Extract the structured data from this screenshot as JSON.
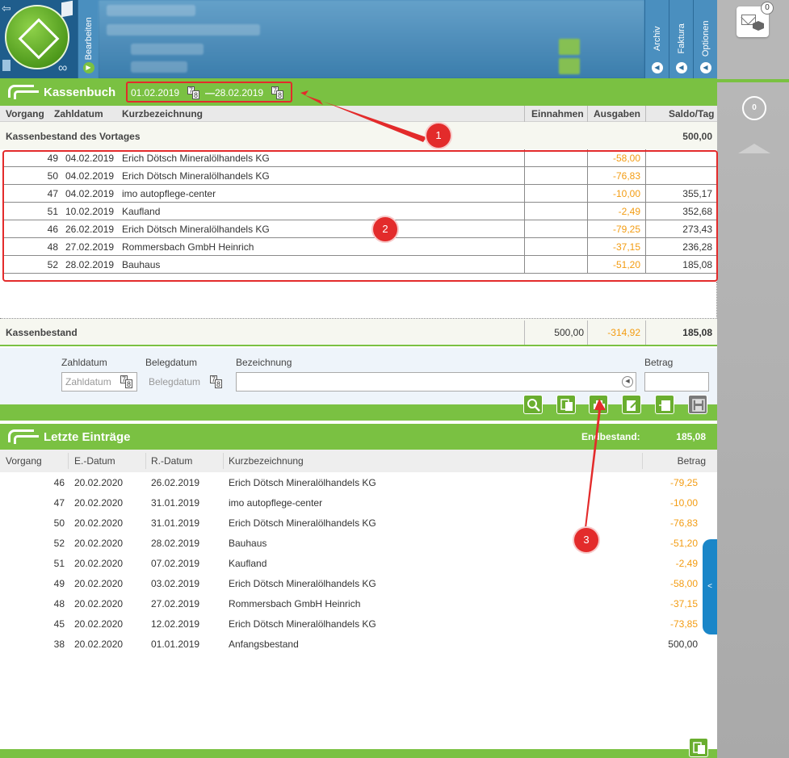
{
  "topbar": {
    "tabs": [
      {
        "label": "Bearbeiten"
      },
      {
        "label": "Archiv"
      },
      {
        "label": "Faktura"
      },
      {
        "label": "Optionen"
      }
    ]
  },
  "rightpanel": {
    "mail_badge": "0",
    "count": "0"
  },
  "kassenbuch": {
    "title": "Kassenbuch",
    "date_from": "01.02.2019",
    "date_sep": "—",
    "date_to": "28.02.2019",
    "cal_top": "7",
    "cal_bottom": "8",
    "columns": {
      "vorgang": "Vorgang",
      "zahldatum": "Zahldatum",
      "kurzbezeichnung": "Kurzbezeichnung",
      "einnahmen": "Einnahmen",
      "ausgaben": "Ausgaben",
      "saldo": "Saldo/Tag"
    },
    "prev_label": "Kassenbestand des Vortages",
    "prev_value": "500,00",
    "rows": [
      {
        "vorgang": "49",
        "datum": "04.02.2019",
        "bez": "Erich Dötsch Mineralölhandels KG",
        "einnahmen": "",
        "ausgaben": "-58,00",
        "saldo": ""
      },
      {
        "vorgang": "50",
        "datum": "04.02.2019",
        "bez": "Erich Dötsch Mineralölhandels KG",
        "einnahmen": "",
        "ausgaben": "-76,83",
        "saldo": ""
      },
      {
        "vorgang": "47",
        "datum": "04.02.2019",
        "bez": "imo autopflege-center",
        "einnahmen": "",
        "ausgaben": "-10,00",
        "saldo": "355,17"
      },
      {
        "vorgang": "51",
        "datum": "10.02.2019",
        "bez": "Kaufland",
        "einnahmen": "",
        "ausgaben": "-2,49",
        "saldo": "352,68"
      },
      {
        "vorgang": "46",
        "datum": "26.02.2019",
        "bez": "Erich Dötsch Mineralölhandels KG",
        "einnahmen": "",
        "ausgaben": "-79,25",
        "saldo": "273,43"
      },
      {
        "vorgang": "48",
        "datum": "27.02.2019",
        "bez": "Rommersbach GmbH Heinrich",
        "einnahmen": "",
        "ausgaben": "-37,15",
        "saldo": "236,28"
      },
      {
        "vorgang": "52",
        "datum": "28.02.2019",
        "bez": "Bauhaus",
        "einnahmen": "",
        "ausgaben": "-51,20",
        "saldo": "185,08"
      }
    ],
    "total_label": "Kassenbestand",
    "total_einnahmen": "500,00",
    "total_ausgaben": "-314,92",
    "total_saldo": "185,08"
  },
  "form": {
    "zahldatum_label": "Zahldatum",
    "zahldatum_placeholder": "Zahldatum",
    "belegdatum_label": "Belegdatum",
    "belegdatum_placeholder": "Belegdatum",
    "bezeichnung_label": "Bezeichnung",
    "betrag_label": "Betrag"
  },
  "toolbar": {
    "icons": [
      "search-icon",
      "copy-icon",
      "print-icon",
      "edit-icon",
      "export-icon",
      "save-icon"
    ]
  },
  "letzte": {
    "title": "Letzte Einträge",
    "bestand_label": "Endbestand:",
    "bestand_value": "185,08",
    "columns": {
      "vorgang": "Vorgang",
      "edatum": "E.-Datum",
      "rdatum": "R.-Datum",
      "kurzbezeichnung": "Kurzbezeichnung",
      "betrag": "Betrag"
    },
    "rows": [
      {
        "vorgang": "46",
        "edatum": "20.02.2020",
        "rdatum": "26.02.2019",
        "bez": "Erich Dötsch Mineralölhandels KG",
        "betrag": "-79,25",
        "neg": true
      },
      {
        "vorgang": "47",
        "edatum": "20.02.2020",
        "rdatum": "31.01.2019",
        "bez": "imo autopflege-center",
        "betrag": "-10,00",
        "neg": true
      },
      {
        "vorgang": "50",
        "edatum": "20.02.2020",
        "rdatum": "31.01.2019",
        "bez": "Erich Dötsch Mineralölhandels KG",
        "betrag": "-76,83",
        "neg": true
      },
      {
        "vorgang": "52",
        "edatum": "20.02.2020",
        "rdatum": "28.02.2019",
        "bez": "Bauhaus",
        "betrag": "-51,20",
        "neg": true
      },
      {
        "vorgang": "51",
        "edatum": "20.02.2020",
        "rdatum": "07.02.2019",
        "bez": "Kaufland",
        "betrag": "-2,49",
        "neg": true
      },
      {
        "vorgang": "49",
        "edatum": "20.02.2020",
        "rdatum": "03.02.2019",
        "bez": "Erich Dötsch Mineralölhandels KG",
        "betrag": "-58,00",
        "neg": true
      },
      {
        "vorgang": "48",
        "edatum": "20.02.2020",
        "rdatum": "27.02.2019",
        "bez": "Rommersbach GmbH Heinrich",
        "betrag": "-37,15",
        "neg": true
      },
      {
        "vorgang": "45",
        "edatum": "20.02.2020",
        "rdatum": "12.02.2019",
        "bez": "Erich Dötsch Mineralölhandels KG",
        "betrag": "-73,85",
        "neg": true
      },
      {
        "vorgang": "38",
        "edatum": "20.02.2020",
        "rdatum": "01.01.2019",
        "bez": "Anfangsbestand",
        "betrag": "500,00",
        "neg": false
      }
    ]
  },
  "annotations": {
    "marker_1": "1",
    "marker_2": "2",
    "marker_3": "3",
    "color": "#e32b2b"
  },
  "colors": {
    "accent_green": "#7ac142",
    "topbar_blue": "#2c6f9f",
    "negative_orange": "#f39c12",
    "side_tab_blue": "#1a86c8"
  },
  "side_tab": {
    "label": "<"
  }
}
